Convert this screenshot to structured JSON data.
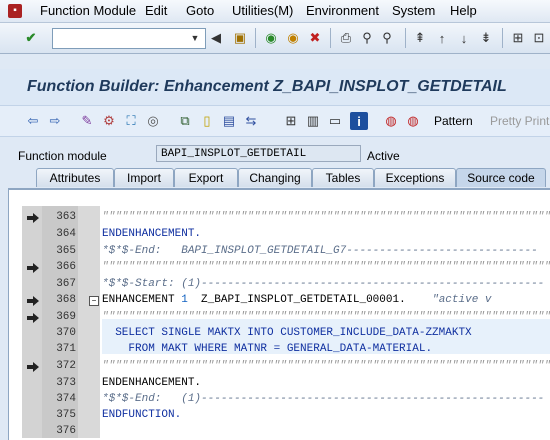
{
  "menu": [
    {
      "label": "Function Module"
    },
    {
      "label": "Edit"
    },
    {
      "label": "Goto"
    },
    {
      "label": "Utilities(M)"
    },
    {
      "label": "Environment"
    },
    {
      "label": "System"
    },
    {
      "label": "Help"
    }
  ],
  "title": "Function Builder: Enhancement Z_BAPI_INSPLOT_GETDETAIL",
  "toolbar": {
    "pattern_label": "Pattern",
    "pretty_printer_label": "Pretty Print"
  },
  "function_module": {
    "label": "Function module",
    "value": "BAPI_INSPLOT_GETDETAIL",
    "status": "Active"
  },
  "tabs": [
    {
      "label": "Attributes"
    },
    {
      "label": "Import"
    },
    {
      "label": "Export"
    },
    {
      "label": "Changing"
    },
    {
      "label": "Tables"
    },
    {
      "label": "Exceptions"
    },
    {
      "label": "Source code"
    }
  ],
  "code_lines": [
    {
      "num": "363",
      "text": "\"\"\"\"\"\"\"\"\"\"\"\"\"\"\"\"\"\"\"\"\"\"\"\"\"\"\"\"\"\"\"\"\"\"\"\"\"\"\"\"\"\"\"\"\"\"\"\"\"\"\"\"\"\"\"\"\"\"\"\"\"\"\"\"\"\"\"\""
    },
    {
      "num": "364",
      "text": "ENDENHANCEMENT."
    },
    {
      "num": "365",
      "text": "*$*$-End:   BAPI_INSPLOT_GETDETAIL_G7-----------------------------"
    },
    {
      "num": "366",
      "text": "\"\"\"\"\"\"\"\"\"\"\"\"\"\"\"\"\"\"\"\"\"\"\"\"\"\"\"\"\"\"\"\"\"\"\"\"\"\"\"\"\"\"\"\"\"\"\"\"\"\"\"\"\"\"\"\"\"\"\"\"\"\"\"\"\"\"\"\""
    },
    {
      "num": "367",
      "text": "*$*$-Start: (1)----------------------------------------------------"
    },
    {
      "num": "368",
      "kw": "ENHANCEMENT",
      "n": "1",
      "rest": "  Z_BAPI_INSPLOT_GETDETAIL_00001.",
      "cmt": "    \"active v"
    },
    {
      "num": "369",
      "text": "\"\"\"\"\"\"\"\"\"\"\"\"\"\"\"\"\"\"\"\"\"\"\"\"\"\"\"\"\"\"\"\"\"\"\"\"\"\"\"\"\"\"\"\"\"\"\"\"\"\"\"\"\"\"\"\"\"\"\"\"\"\"\"\"\"\"\"\""
    },
    {
      "num": "370",
      "text": "  SELECT SINGLE MAKTX INTO CUSTOMER_INCLUDE_DATA-ZZMAKTX"
    },
    {
      "num": "371",
      "text": "    FROM MAKT WHERE MATNR = GENERAL_DATA-MATERIAL."
    },
    {
      "num": "372",
      "text": "\"\"\"\"\"\"\"\"\"\"\"\"\"\"\"\"\"\"\"\"\"\"\"\"\"\"\"\"\"\"\"\"\"\"\"\"\"\"\"\"\"\"\"\"\"\"\"\"\"\"\"\"\"\"\"\"\"\"\"\"\"\"\"\"\"\"\"\""
    },
    {
      "num": "373",
      "text": "ENDENHANCEMENT."
    },
    {
      "num": "374",
      "text": "*$*$-End:   (1)----------------------------------------------------"
    },
    {
      "num": "375",
      "text": "ENDFUNCTION."
    },
    {
      "num": "376",
      "text": ""
    }
  ]
}
